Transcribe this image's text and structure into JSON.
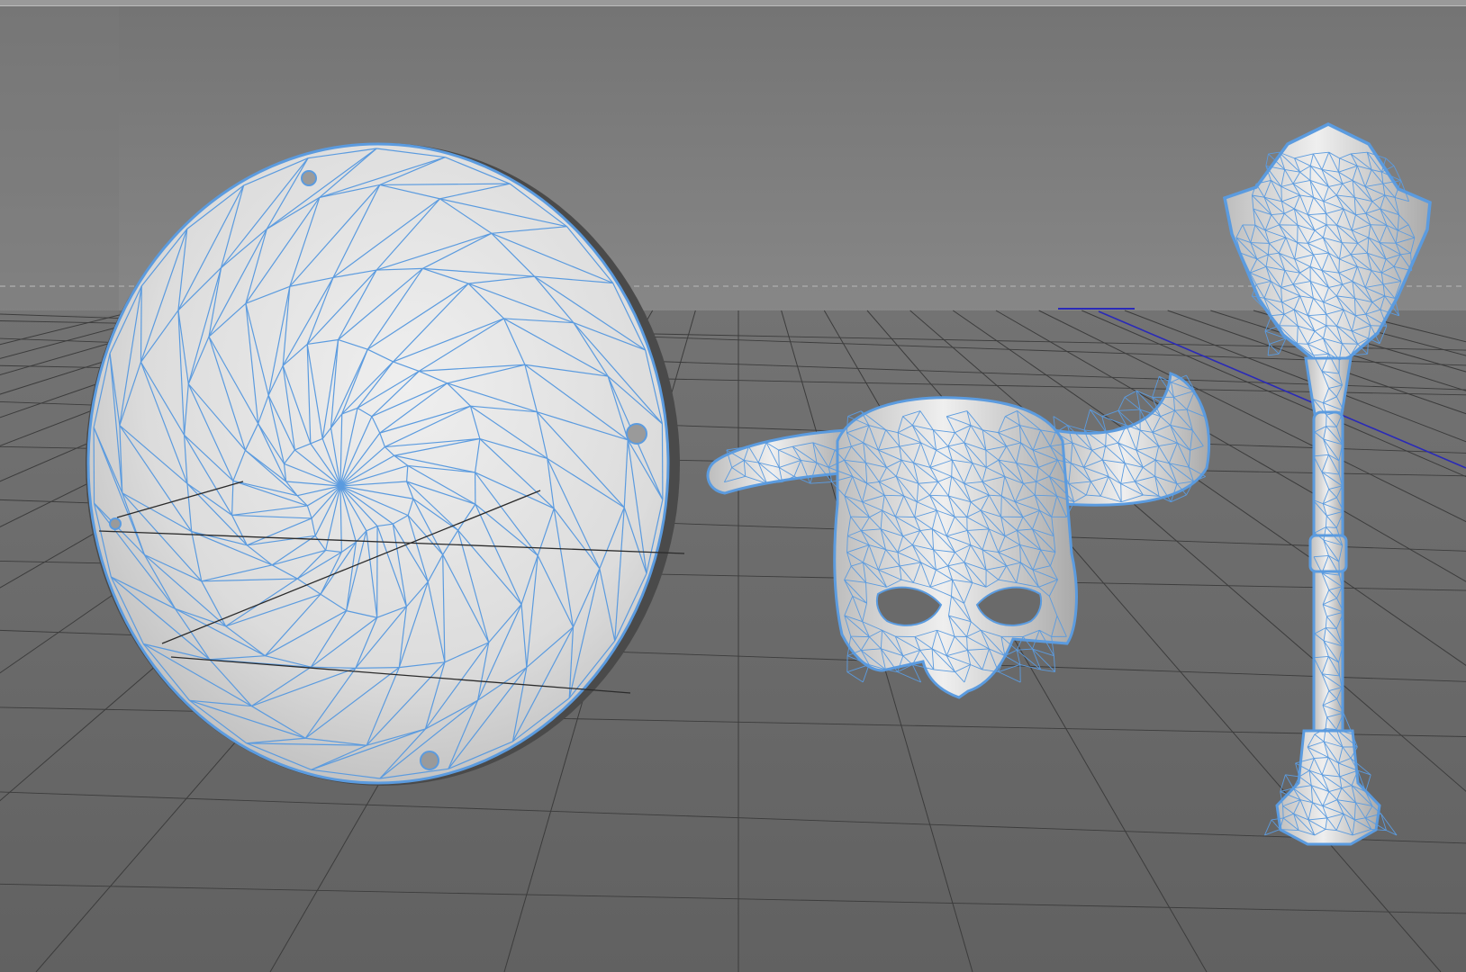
{
  "viewport": {
    "mode": "wireframe-on-shaded",
    "colors": {
      "wireframe": "#5b9bdf",
      "wireframe_outline": "#4a86cf",
      "surface_light": "#e6e6e6",
      "surface_shadow": "#a9a9a9",
      "sky_top": "#757575",
      "sky_horizon": "#858585",
      "floor": "#6a6a6a",
      "grid_line": "#3c3c3c",
      "axis_line": "#1e1ea8"
    }
  },
  "scene": {
    "objects": [
      {
        "name": "shield",
        "selected": true
      },
      {
        "name": "horned-helmet",
        "selected": true
      },
      {
        "name": "mace",
        "selected": true
      }
    ]
  }
}
